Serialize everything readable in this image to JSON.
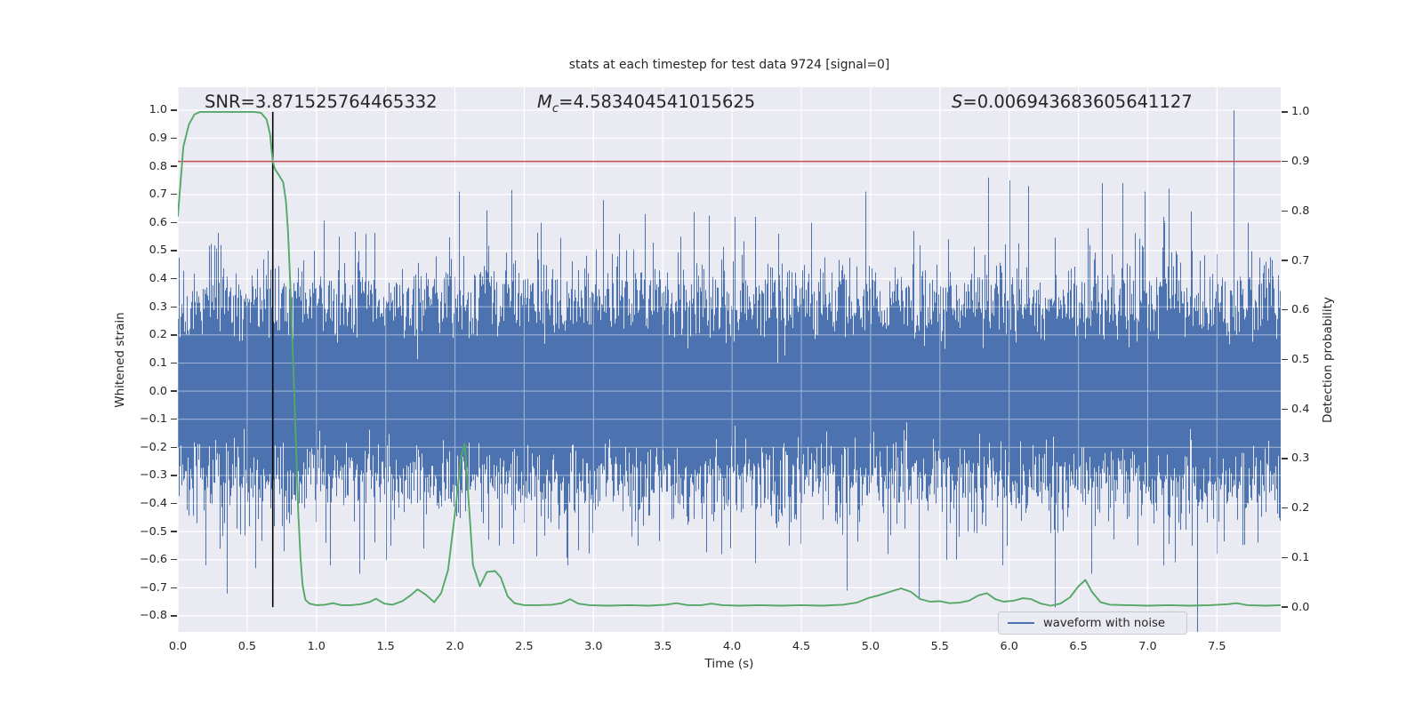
{
  "figure": {
    "title": "stats at each timestep for test data 9724 [signal=0]",
    "xlabel": "Time (s)",
    "ylabel_left": "Whitened strain",
    "ylabel_right": "Detection probability",
    "legend_label": "waveform with noise",
    "annotations": {
      "snr": "SNR=3.871525764465332",
      "mc_symbol": "M",
      "mc_sub": "c",
      "mc_value": "=4.583404541015625",
      "s_symbol": "S",
      "s_value": "=0.006943683605641127"
    }
  },
  "colors": {
    "figure_bg": "#ffffff",
    "axes_bg": "#eaeaf2",
    "grid": "#ffffff",
    "waveform": "#4c72b0",
    "probability": "#55a868",
    "threshold": "#c44e52",
    "event_line": "#000000",
    "text": "#262626"
  },
  "chart_data": {
    "type": "line",
    "title": "stats at each timestep for test data 9724 [signal=0]",
    "xlabel": "Time (s)",
    "ylabel_left": "Whitened strain",
    "ylabel_right": "Detection probability",
    "xlim": [
      0,
      7.96
    ],
    "ylim_left": [
      -0.857,
      1.082
    ],
    "ylim_right": [
      -0.05,
      1.05
    ],
    "grid": true,
    "legend_position": "lower right",
    "xticks": {
      "values": [
        0.0,
        0.5,
        1.0,
        1.5,
        2.0,
        2.5,
        3.0,
        3.5,
        4.0,
        4.5,
        5.0,
        5.5,
        6.0,
        6.5,
        7.0,
        7.5
      ],
      "labels": [
        "0.0",
        "0.5",
        "1.0",
        "1.5",
        "2.0",
        "2.5",
        "3.0",
        "3.5",
        "4.0",
        "4.5",
        "5.0",
        "5.5",
        "6.0",
        "6.5",
        "7.0",
        "7.5"
      ]
    },
    "yticks_left": {
      "values": [
        1.0,
        0.9,
        0.8,
        0.7,
        0.6,
        0.5,
        0.4,
        0.3,
        0.2,
        0.1,
        0.0,
        -0.1,
        -0.2,
        -0.3,
        -0.4,
        -0.5,
        -0.6,
        -0.7,
        -0.8
      ],
      "labels": [
        "1.0",
        "0.9",
        "0.8",
        "0.7",
        "0.6",
        "0.5",
        "0.4",
        "0.3",
        "0.2",
        "0.1",
        "0.0",
        "−0.1",
        "−0.2",
        "−0.3",
        "−0.4",
        "−0.5",
        "−0.6",
        "−0.7",
        "−0.8"
      ]
    },
    "yticks_right": {
      "values": [
        1.0,
        0.9,
        0.8,
        0.7,
        0.6,
        0.5,
        0.4,
        0.3,
        0.2,
        0.1,
        0.0
      ],
      "labels": [
        "1.0",
        "0.9",
        "0.8",
        "0.7",
        "0.6",
        "0.5",
        "0.4",
        "0.3",
        "0.2",
        "0.1",
        "0.0"
      ]
    },
    "threshold": {
      "axis": "right",
      "value": 0.9
    },
    "event_time": 0.685,
    "series": [
      {
        "name": "waveform with noise",
        "type": "noise_band",
        "axis": "left",
        "seed": 9724,
        "sigma": 0.165,
        "samples_per_column": 26,
        "tail_probability": 0.005,
        "spikes": [
          [
            0.2,
            -0.62
          ],
          [
            0.31,
            0.52
          ],
          [
            0.35,
            -0.72
          ],
          [
            0.56,
            -0.63
          ],
          [
            0.65,
            0.5
          ],
          [
            1.1,
            -0.62
          ],
          [
            1.16,
            0.55
          ],
          [
            1.31,
            -0.65
          ],
          [
            1.77,
            -0.56
          ],
          [
            2.03,
            0.71
          ],
          [
            2.32,
            -0.55
          ],
          [
            2.62,
            0.6
          ],
          [
            2.81,
            -0.62
          ],
          [
            3.07,
            0.68
          ],
          [
            3.32,
            -0.55
          ],
          [
            3.37,
            0.63
          ],
          [
            3.63,
            0.55
          ],
          [
            3.92,
            -0.58
          ],
          [
            4.02,
            0.62
          ],
          [
            4.33,
            0.56
          ],
          [
            4.41,
            -0.55
          ],
          [
            4.57,
            0.6
          ],
          [
            4.83,
            -0.71
          ],
          [
            4.96,
            0.71
          ],
          [
            5.12,
            -0.58
          ],
          [
            5.31,
            0.57
          ],
          [
            5.56,
            0.54
          ],
          [
            5.62,
            -0.6
          ],
          [
            5.85,
            0.76
          ],
          [
            5.95,
            -0.62
          ],
          [
            6.0,
            0.75
          ],
          [
            6.14,
            0.73
          ],
          [
            6.33,
            -0.77
          ],
          [
            6.59,
            -0.65
          ],
          [
            6.67,
            0.74
          ],
          [
            6.82,
            0.74
          ],
          [
            6.98,
            0.71
          ],
          [
            7.11,
            0.62
          ],
          [
            7.15,
            0.72
          ],
          [
            7.32,
            -0.55
          ],
          [
            7.5,
            -0.58
          ],
          [
            7.62,
            1.0
          ]
        ]
      },
      {
        "name": "detection probability",
        "type": "line",
        "axis": "right",
        "points": [
          [
            0.0,
            0.79
          ],
          [
            0.04,
            0.93
          ],
          [
            0.08,
            0.975
          ],
          [
            0.12,
            0.995
          ],
          [
            0.16,
            1.0
          ],
          [
            0.25,
            1.0
          ],
          [
            0.35,
            1.0
          ],
          [
            0.45,
            1.0
          ],
          [
            0.55,
            1.0
          ],
          [
            0.6,
            0.998
          ],
          [
            0.64,
            0.985
          ],
          [
            0.665,
            0.955
          ],
          [
            0.685,
            0.9
          ],
          [
            0.7,
            0.885
          ],
          [
            0.73,
            0.872
          ],
          [
            0.76,
            0.858
          ],
          [
            0.78,
            0.82
          ],
          [
            0.795,
            0.76
          ],
          [
            0.81,
            0.66
          ],
          [
            0.825,
            0.55
          ],
          [
            0.84,
            0.43
          ],
          [
            0.855,
            0.31
          ],
          [
            0.87,
            0.185
          ],
          [
            0.885,
            0.1
          ],
          [
            0.9,
            0.045
          ],
          [
            0.92,
            0.015
          ],
          [
            0.95,
            0.007
          ],
          [
            1.0,
            0.004
          ],
          [
            1.06,
            0.005
          ],
          [
            1.12,
            0.008
          ],
          [
            1.18,
            0.004
          ],
          [
            1.25,
            0.004
          ],
          [
            1.32,
            0.006
          ],
          [
            1.38,
            0.01
          ],
          [
            1.43,
            0.017
          ],
          [
            1.49,
            0.007
          ],
          [
            1.55,
            0.005
          ],
          [
            1.62,
            0.012
          ],
          [
            1.68,
            0.024
          ],
          [
            1.73,
            0.036
          ],
          [
            1.79,
            0.025
          ],
          [
            1.85,
            0.01
          ],
          [
            1.9,
            0.028
          ],
          [
            1.95,
            0.075
          ],
          [
            2.0,
            0.19
          ],
          [
            2.045,
            0.305
          ],
          [
            2.07,
            0.33
          ],
          [
            2.1,
            0.21
          ],
          [
            2.13,
            0.085
          ],
          [
            2.18,
            0.042
          ],
          [
            2.23,
            0.071
          ],
          [
            2.29,
            0.073
          ],
          [
            2.33,
            0.06
          ],
          [
            2.38,
            0.022
          ],
          [
            2.43,
            0.008
          ],
          [
            2.5,
            0.004
          ],
          [
            2.6,
            0.004
          ],
          [
            2.7,
            0.005
          ],
          [
            2.77,
            0.008
          ],
          [
            2.83,
            0.016
          ],
          [
            2.89,
            0.007
          ],
          [
            2.97,
            0.004
          ],
          [
            3.1,
            0.003
          ],
          [
            3.25,
            0.004
          ],
          [
            3.4,
            0.003
          ],
          [
            3.52,
            0.005
          ],
          [
            3.6,
            0.008
          ],
          [
            3.68,
            0.004
          ],
          [
            3.78,
            0.004
          ],
          [
            3.85,
            0.007
          ],
          [
            3.93,
            0.004
          ],
          [
            4.05,
            0.003
          ],
          [
            4.2,
            0.004
          ],
          [
            4.35,
            0.003
          ],
          [
            4.5,
            0.004
          ],
          [
            4.65,
            0.003
          ],
          [
            4.8,
            0.005
          ],
          [
            4.9,
            0.009
          ],
          [
            4.98,
            0.018
          ],
          [
            5.06,
            0.024
          ],
          [
            5.14,
            0.031
          ],
          [
            5.22,
            0.038
          ],
          [
            5.29,
            0.031
          ],
          [
            5.36,
            0.016
          ],
          [
            5.43,
            0.011
          ],
          [
            5.5,
            0.012
          ],
          [
            5.57,
            0.008
          ],
          [
            5.64,
            0.009
          ],
          [
            5.71,
            0.013
          ],
          [
            5.78,
            0.024
          ],
          [
            5.84,
            0.028
          ],
          [
            5.9,
            0.016
          ],
          [
            5.96,
            0.011
          ],
          [
            6.03,
            0.013
          ],
          [
            6.1,
            0.018
          ],
          [
            6.16,
            0.016
          ],
          [
            6.23,
            0.007
          ],
          [
            6.3,
            0.003
          ],
          [
            6.37,
            0.007
          ],
          [
            6.44,
            0.02
          ],
          [
            6.5,
            0.042
          ],
          [
            6.55,
            0.055
          ],
          [
            6.6,
            0.03
          ],
          [
            6.66,
            0.01
          ],
          [
            6.73,
            0.005
          ],
          [
            6.85,
            0.004
          ],
          [
            7.0,
            0.003
          ],
          [
            7.15,
            0.004
          ],
          [
            7.3,
            0.003
          ],
          [
            7.45,
            0.004
          ],
          [
            7.58,
            0.006
          ],
          [
            7.64,
            0.008
          ],
          [
            7.72,
            0.004
          ],
          [
            7.85,
            0.003
          ],
          [
            7.96,
            0.004
          ]
        ]
      }
    ]
  }
}
